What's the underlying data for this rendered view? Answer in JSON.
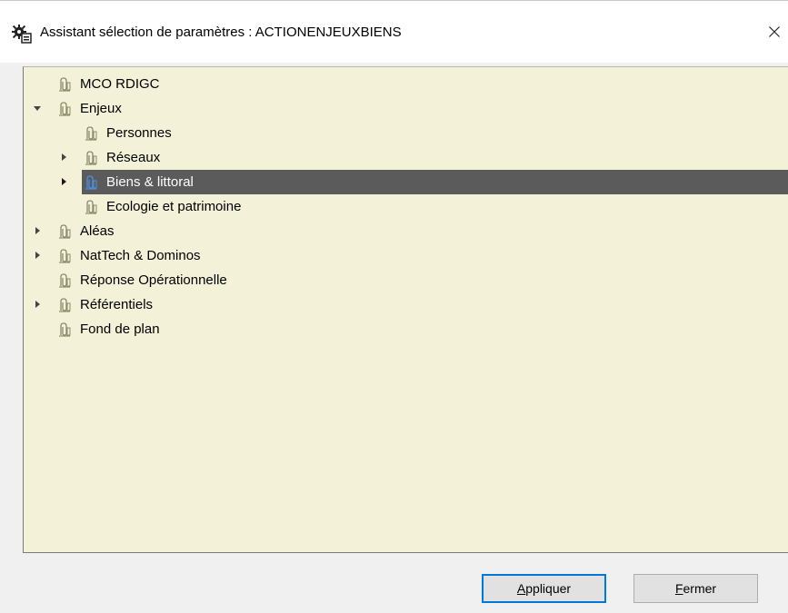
{
  "window": {
    "title": "Assistant sélection de paramètres : ACTIONENJEUXBIENS",
    "close_glyph": "✕"
  },
  "tree": {
    "items": [
      {
        "label": "MCO RDIGC",
        "level": 0,
        "expander": "none",
        "selected": false
      },
      {
        "label": "Enjeux",
        "level": 0,
        "expander": "expanded",
        "selected": false
      },
      {
        "label": "Personnes",
        "level": 1,
        "expander": "none",
        "selected": false
      },
      {
        "label": "Réseaux",
        "level": 1,
        "expander": "collapsed",
        "selected": false
      },
      {
        "label": "Biens & littoral",
        "level": 1,
        "expander": "collapsed",
        "selected": true
      },
      {
        "label": "Ecologie et patrimoine",
        "level": 1,
        "expander": "none",
        "selected": false
      },
      {
        "label": "Aléas",
        "level": 0,
        "expander": "collapsed",
        "selected": false
      },
      {
        "label": "NatTech & Dominos",
        "level": 0,
        "expander": "collapsed",
        "selected": false
      },
      {
        "label": "Réponse Opérationnelle",
        "level": 0,
        "expander": "none",
        "selected": false
      },
      {
        "label": "Référentiels",
        "level": 0,
        "expander": "collapsed",
        "selected": false
      },
      {
        "label": "Fond de plan",
        "level": 0,
        "expander": "none",
        "selected": false
      }
    ]
  },
  "buttons": {
    "apply": {
      "mnemonic": "A",
      "rest": "ppliquer"
    },
    "close": {
      "mnemonic": "F",
      "rest": "ermer"
    }
  },
  "colors": {
    "tree_background": "#f3f2d8",
    "selection_background": "#5b5b5b",
    "primary_button_border": "#0078d7"
  },
  "icons": {
    "app": "settings-gear-icon",
    "node": "clip-icon",
    "expander_collapsed": "triangle-right-icon",
    "expander_expanded": "triangle-down-icon"
  }
}
